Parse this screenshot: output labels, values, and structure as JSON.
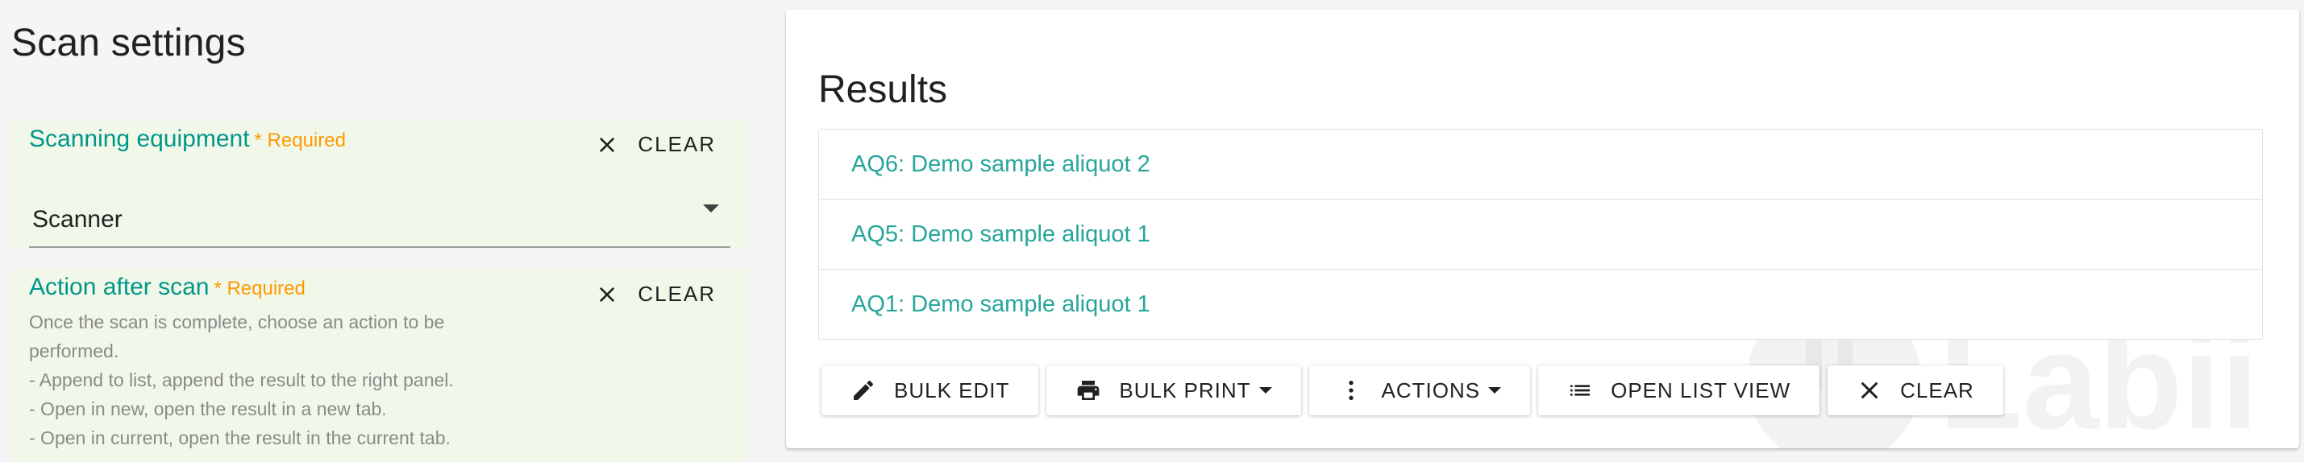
{
  "scan_settings": {
    "title": "Scan settings",
    "equipment": {
      "label": "Scanning equipment",
      "required": "* Required",
      "clear_label": "CLEAR",
      "selected": "Scanner"
    },
    "action_after_scan": {
      "label": "Action after scan",
      "required": "* Required",
      "clear_label": "CLEAR",
      "help_lines": [
        "Once the scan is complete, choose an action to be",
        "performed.",
        "- Append to list, append the result to the right panel.",
        "- Open in new, open the result in a new tab.",
        "- Open in current, open the result in the current tab."
      ]
    }
  },
  "results": {
    "title": "Results",
    "items": [
      "AQ6: Demo sample aliquot 2",
      "AQ5: Demo sample aliquot 1",
      "AQ1: Demo sample aliquot 1"
    ],
    "toolbar": {
      "bulk_edit": "BULK EDIT",
      "bulk_print": "BULK PRINT",
      "actions": "ACTIONS",
      "open_list_view": "OPEN LIST VIEW",
      "clear": "CLEAR"
    },
    "watermark_text": "Labii"
  },
  "colors": {
    "accent": "#009688",
    "link": "#26a69a",
    "required": "#ff9800",
    "card_bg": "#f1f8e9"
  },
  "icons": [
    "close-icon",
    "dropdown-caret-icon",
    "pencil-icon",
    "printer-icon",
    "more-vert-icon",
    "list-icon"
  ]
}
